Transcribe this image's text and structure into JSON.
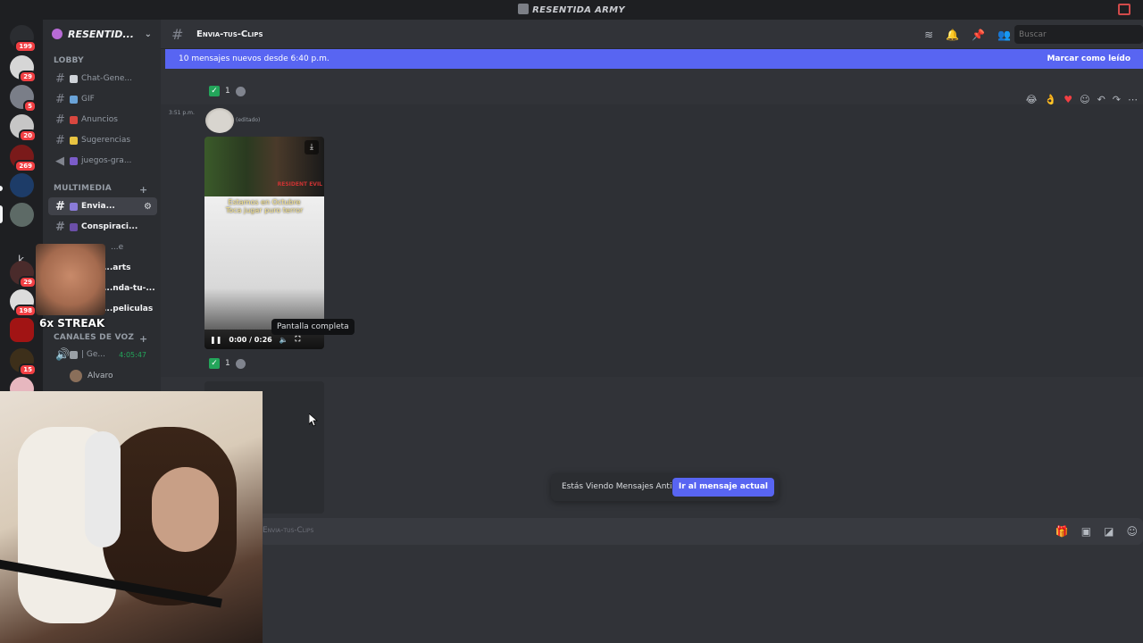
{
  "window": {
    "title": "RESENTIDA ARMY"
  },
  "server": {
    "name": "RESENTID..."
  },
  "server_badges": [
    "199",
    "29",
    "5",
    "20",
    "269",
    "",
    "",
    "",
    "29",
    "198",
    "",
    "15",
    ""
  ],
  "categories": {
    "lobby": "LOBBY",
    "multimedia": "MULTIMEDIA",
    "voice": "CANALES DE VOZ"
  },
  "channels": {
    "lobby": [
      "Chat-Gene...",
      "GIF",
      "Anuncios",
      "Sugerencias",
      "juegos-gra..."
    ],
    "multimedia": [
      "Envia...",
      "Conspiraci...",
      "...e",
      "...arts",
      "...nda-tu-...",
      "...peliculas"
    ],
    "voice": {
      "name": "| Ge...",
      "time": "4:05:47",
      "user": "Alvaro"
    }
  },
  "header": {
    "channel": "Envia-tus-Clips",
    "search_placeholder": "Buscar",
    "icons": [
      "threads-icon",
      "bell-icon",
      "pin-icon",
      "members-icon"
    ]
  },
  "banner": {
    "new_messages": "10 mensajes nuevos desde 6:40 p.m.",
    "mark_read": "Marcar como leído"
  },
  "message": {
    "timestamp": "3:51 p.m.",
    "edited": "(editado)",
    "reaction_count": "1",
    "video_caption_1": "Estamos en Octubre",
    "video_caption_2": "Toca jugar puro terror",
    "video_brand": "RESIDENT EVIL",
    "video_time": "0:00 / 0:26",
    "tooltip": "Pantalla completa"
  },
  "old_messages": {
    "text": "Estás Viendo Mensajes Antiguos",
    "button": "Ir al mensaje actual"
  },
  "composer": {
    "placeholder": "Envia-tus-Clips"
  },
  "overlay": {
    "streak": "6x STREAK"
  },
  "colors": {
    "blurple": "#5865f2",
    "green": "#23a55a",
    "red": "#f23f43"
  }
}
